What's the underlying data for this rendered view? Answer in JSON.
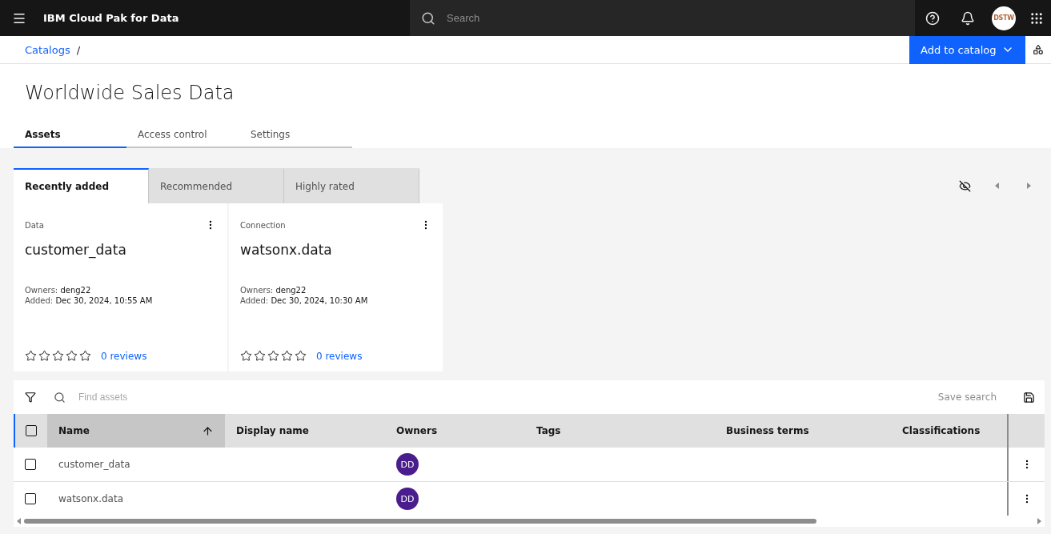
{
  "header": {
    "product": "IBM Cloud Pak for Data",
    "search_placeholder": "Search",
    "avatar": "DSTW"
  },
  "breadcrumb": {
    "items": [
      "Catalogs"
    ],
    "separator": "/"
  },
  "add_button": "Add to catalog",
  "title": "Worldwide Sales Data",
  "tabs": [
    {
      "label": "Assets",
      "selected": true
    },
    {
      "label": "Access control",
      "selected": false
    },
    {
      "label": "Settings",
      "selected": false
    }
  ],
  "content_tabs": [
    {
      "label": "Recently added",
      "selected": true
    },
    {
      "label": "Recommended",
      "selected": false
    },
    {
      "label": "Highly rated",
      "selected": false
    }
  ],
  "cards": [
    {
      "type": "Data",
      "name": "customer_data",
      "owners_label": "Owners:",
      "owners": "deng22",
      "added_label": "Added:",
      "added": "Dec 30, 2024, 10:55 AM",
      "stars": 0,
      "reviews": "0 reviews"
    },
    {
      "type": "Connection",
      "name": "watsonx.data",
      "owners_label": "Owners:",
      "owners": "deng22",
      "added_label": "Added:",
      "added": "Dec 30, 2024, 10:30 AM",
      "stars": 0,
      "reviews": "0 reviews"
    }
  ],
  "table": {
    "search_placeholder": "Find assets",
    "save_search": "Save search",
    "all_checked": false,
    "columns": [
      {
        "label": "Name",
        "sorted": true
      },
      {
        "label": "Display name",
        "sorted": false
      },
      {
        "label": "Owners",
        "sorted": false
      },
      {
        "label": "Tags",
        "sorted": false
      },
      {
        "label": "Business terms",
        "sorted": false
      },
      {
        "label": "Classifications",
        "sorted": false
      }
    ],
    "rows": [
      {
        "name": "customer_data",
        "owner_initials": "DD",
        "checked": false
      },
      {
        "name": "watsonx.data",
        "owner_initials": "DD",
        "checked": false
      }
    ]
  }
}
